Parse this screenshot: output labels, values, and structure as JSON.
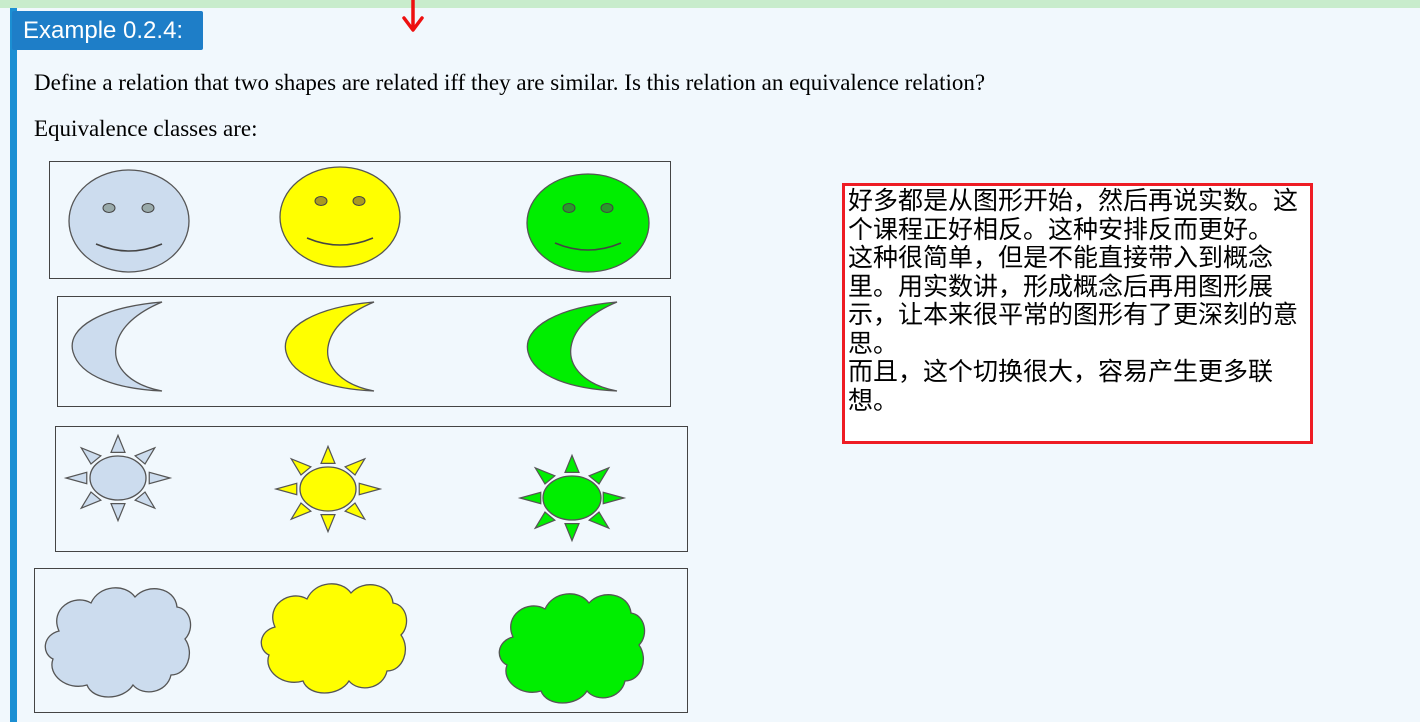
{
  "example_tag": "Example 0.2.4:",
  "question": "Define a relation that two shapes are related iff they are similar. Is this relation an equivalence relation?",
  "classes_intro": "Equivalence classes are:",
  "note": {
    "paragraphs": [
      "好多都是从图形开始，然后再说实数。这个课程正好相反。这种安排反而更好。",
      "这种很简单，但是不能直接带入到概念里。用实数讲，形成概念后再用图形展示，让本来很平常的图形有了更深刻的意思。",
      "而且，这个切换很大，容易产生更多联想。"
    ]
  },
  "colors": {
    "accent": "#1e7ec8",
    "note_border": "#ee1c24",
    "shape_blue": "#ccdcee",
    "shape_yellow": "#ffff00",
    "shape_green": "#00ee00"
  },
  "equivalence_classes": [
    {
      "shape": "smiley-face",
      "colors": [
        "light-blue",
        "yellow",
        "green"
      ]
    },
    {
      "shape": "crescent-moon",
      "colors": [
        "light-blue",
        "yellow",
        "green"
      ]
    },
    {
      "shape": "sun",
      "colors": [
        "light-blue",
        "yellow",
        "green"
      ]
    },
    {
      "shape": "cloud",
      "colors": [
        "light-blue",
        "yellow",
        "green"
      ]
    }
  ]
}
